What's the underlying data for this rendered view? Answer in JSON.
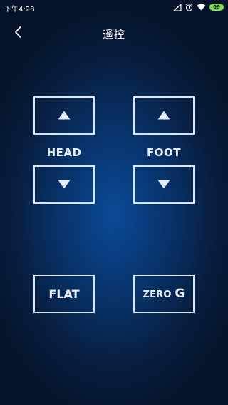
{
  "status_bar": {
    "time": "下午4:28",
    "battery": "69",
    "icons": [
      "signal-muted-icon",
      "alarm-icon",
      "wifi-icon",
      "battery-icon"
    ]
  },
  "header": {
    "back_icon": "chevron-left-icon",
    "title": "遥控"
  },
  "controls": {
    "head": {
      "label": "HEAD",
      "up_icon": "triangle-up-icon",
      "down_icon": "triangle-down-icon"
    },
    "foot": {
      "label": "FOOT",
      "up_icon": "triangle-up-icon",
      "down_icon": "triangle-down-icon"
    },
    "flat": {
      "label": "FLAT"
    },
    "zero_g": {
      "label_main": "ZERO ",
      "label_g": "G"
    }
  },
  "colors": {
    "background_center": "#0a4a96",
    "background_edge": "#06142b",
    "button_border": "#d9e6f7",
    "text": "#e8eef7",
    "battery": "#7ed957"
  }
}
